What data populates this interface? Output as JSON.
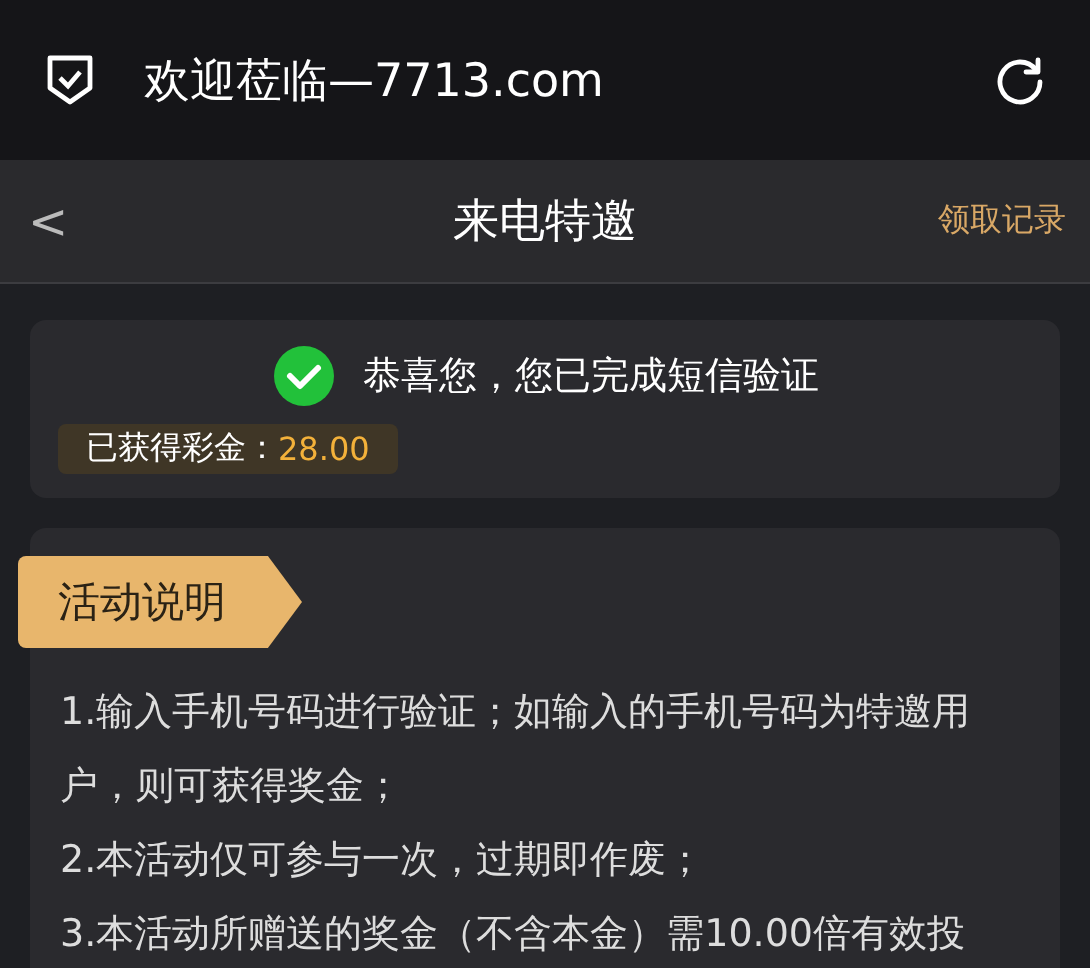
{
  "browser_bar": {
    "title": "欢迎莅临—7713.com"
  },
  "nav_bar": {
    "back": "<",
    "title": "来电特邀",
    "action": "领取记录"
  },
  "verification_card": {
    "message": "恭喜您，您已完成短信验证",
    "bonus_label": "已获得彩金：",
    "bonus_value": "28.00"
  },
  "activity_card": {
    "tag": "活动说明",
    "rules": [
      "1.输入手机号码进行验证；如输入的手机号码为特邀用户，则可获得奖金；",
      "2.本活动仅可参与一次，过期即作废；",
      "3.本活动所赠送的奖金（不含本金）需10.00倍有效投"
    ]
  }
}
